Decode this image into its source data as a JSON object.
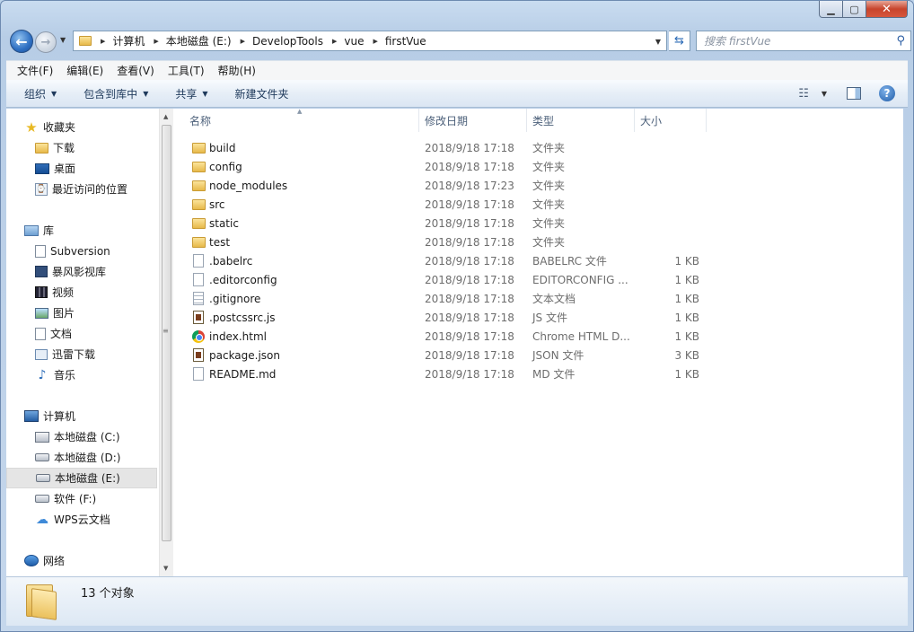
{
  "window": {
    "min_glyph": "▁",
    "max_glyph": "▢",
    "close_glyph": "✕"
  },
  "nav": {
    "back_glyph": "←",
    "forward_glyph": "→",
    "breadcrumbs": [
      "计算机",
      "本地磁盘 (E:)",
      "DevelopTools",
      "vue",
      "firstVue"
    ],
    "search_placeholder": "搜索 firstVue"
  },
  "menubar": [
    "文件(F)",
    "编辑(E)",
    "查看(V)",
    "工具(T)",
    "帮助(H)"
  ],
  "commands": [
    {
      "label": "组织",
      "dropdown": true
    },
    {
      "label": "包含到库中",
      "dropdown": true
    },
    {
      "label": "共享",
      "dropdown": true
    },
    {
      "label": "新建文件夹",
      "dropdown": false
    }
  ],
  "help_glyph": "?",
  "sidebar": {
    "favorites": {
      "label": "收藏夹",
      "icon": "star-icon",
      "items": [
        {
          "label": "下载",
          "icon": "download-folder-icon"
        },
        {
          "label": "桌面",
          "icon": "desktop-icon"
        },
        {
          "label": "最近访问的位置",
          "icon": "recent-places-icon"
        }
      ]
    },
    "libraries": {
      "label": "库",
      "icon": "library-icon",
      "items": [
        {
          "label": "Subversion",
          "icon": "document-library-icon"
        },
        {
          "label": "暴风影视库",
          "icon": "media-library-icon"
        },
        {
          "label": "视频",
          "icon": "video-library-icon"
        },
        {
          "label": "图片",
          "icon": "pictures-library-icon"
        },
        {
          "label": "文档",
          "icon": "documents-library-icon"
        },
        {
          "label": "迅雷下载",
          "icon": "thunder-download-icon"
        },
        {
          "label": "音乐",
          "icon": "music-library-icon"
        }
      ]
    },
    "computer": {
      "label": "计算机",
      "icon": "computer-icon",
      "items": [
        {
          "label": "本地磁盘 (C:)",
          "icon": "system-drive-icon"
        },
        {
          "label": "本地磁盘 (D:)",
          "icon": "drive-icon"
        },
        {
          "label": "本地磁盘 (E:)",
          "icon": "drive-icon",
          "selected": true
        },
        {
          "label": "软件 (F:)",
          "icon": "drive-icon"
        },
        {
          "label": "WPS云文档",
          "icon": "cloud-icon"
        }
      ]
    },
    "network": {
      "label": "网络",
      "icon": "network-icon"
    }
  },
  "columns": {
    "name": "名称",
    "date": "修改日期",
    "type": "类型",
    "size": "大小"
  },
  "files": [
    {
      "name": "build",
      "date": "2018/9/18 17:18",
      "type": "文件夹",
      "size": "",
      "icon": "folder"
    },
    {
      "name": "config",
      "date": "2018/9/18 17:18",
      "type": "文件夹",
      "size": "",
      "icon": "folder"
    },
    {
      "name": "node_modules",
      "date": "2018/9/18 17:23",
      "type": "文件夹",
      "size": "",
      "icon": "folder"
    },
    {
      "name": "src",
      "date": "2018/9/18 17:18",
      "type": "文件夹",
      "size": "",
      "icon": "folder"
    },
    {
      "name": "static",
      "date": "2018/9/18 17:18",
      "type": "文件夹",
      "size": "",
      "icon": "folder"
    },
    {
      "name": "test",
      "date": "2018/9/18 17:18",
      "type": "文件夹",
      "size": "",
      "icon": "folder"
    },
    {
      "name": ".babelrc",
      "date": "2018/9/18 17:18",
      "type": "BABELRC 文件",
      "size": "1 KB",
      "icon": "file"
    },
    {
      "name": ".editorconfig",
      "date": "2018/9/18 17:18",
      "type": "EDITORCONFIG ...",
      "size": "1 KB",
      "icon": "file"
    },
    {
      "name": ".gitignore",
      "date": "2018/9/18 17:18",
      "type": "文本文档",
      "size": "1 KB",
      "icon": "text"
    },
    {
      "name": ".postcssrc.js",
      "date": "2018/9/18 17:18",
      "type": "JS 文件",
      "size": "1 KB",
      "icon": "code"
    },
    {
      "name": "index.html",
      "date": "2018/9/18 17:18",
      "type": "Chrome HTML D...",
      "size": "1 KB",
      "icon": "chrome"
    },
    {
      "name": "package.json",
      "date": "2018/9/18 17:18",
      "type": "JSON 文件",
      "size": "3 KB",
      "icon": "code"
    },
    {
      "name": "README.md",
      "date": "2018/9/18 17:18",
      "type": "MD 文件",
      "size": "1 KB",
      "icon": "file"
    }
  ],
  "status": {
    "text": "13 个对象"
  }
}
